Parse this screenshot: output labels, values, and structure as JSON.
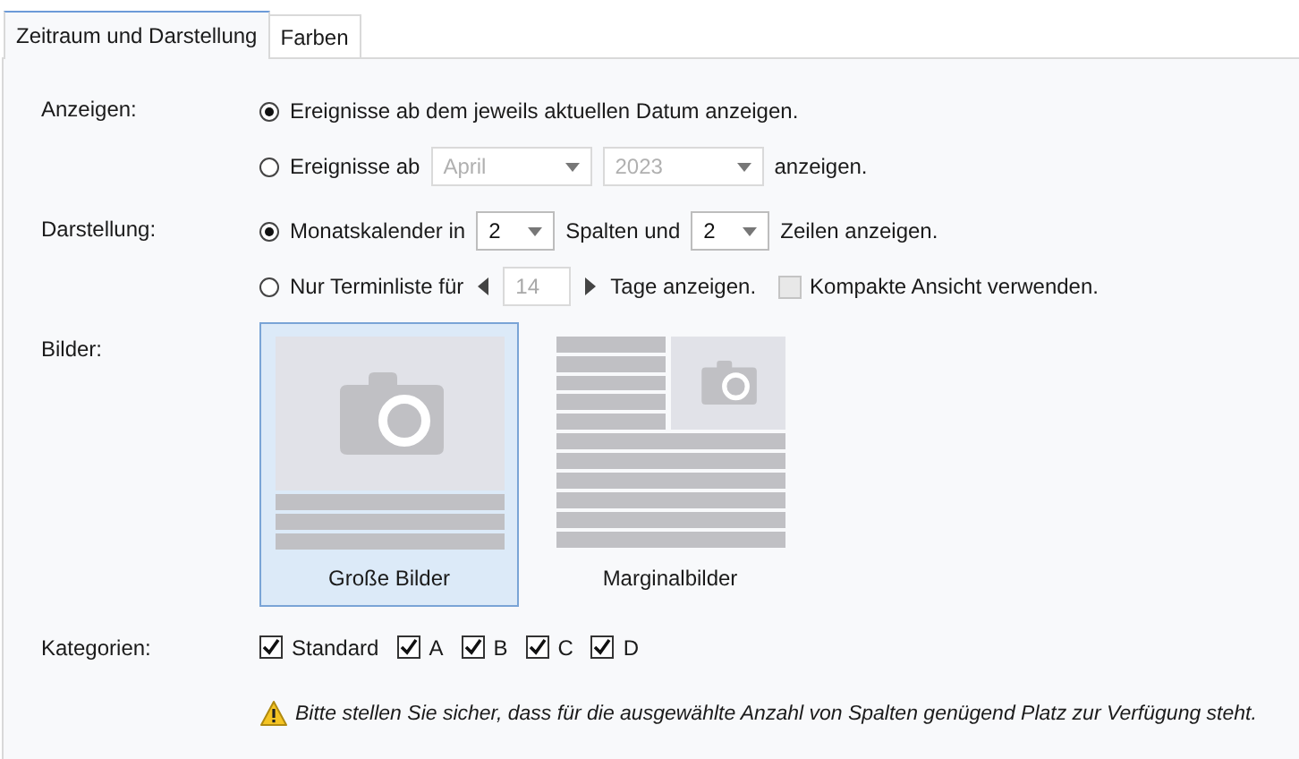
{
  "tabs": [
    {
      "label": "Zeitraum und Darstellung",
      "selected": true
    },
    {
      "label": "Farben",
      "selected": false
    }
  ],
  "anzeigen": {
    "label": "Anzeigen:",
    "options": [
      {
        "selected": true,
        "parts": [
          {
            "kind": "text",
            "text": "Ereignisse ab dem jeweils aktuellen Datum anzeigen."
          }
        ]
      },
      {
        "selected": false,
        "parts": [
          {
            "kind": "text",
            "text": "Ereignisse ab"
          },
          {
            "kind": "dropdown",
            "value": "April",
            "disabled": true
          },
          {
            "kind": "dropdown",
            "value": "2023",
            "disabled": true
          },
          {
            "kind": "text",
            "text": "anzeigen."
          }
        ]
      }
    ]
  },
  "darstellung": {
    "label": "Darstellung:",
    "options": [
      {
        "selected": true,
        "parts": [
          {
            "kind": "text",
            "text": "Monatskalender in"
          },
          {
            "kind": "dropdown",
            "value": "2",
            "disabled": false
          },
          {
            "kind": "text",
            "text": "Spalten und"
          },
          {
            "kind": "dropdown",
            "value": "2",
            "disabled": false
          },
          {
            "kind": "text",
            "text": "Zeilen anzeigen."
          }
        ]
      },
      {
        "selected": false,
        "parts": [
          {
            "kind": "text",
            "text": "Nur Terminliste für"
          },
          {
            "kind": "spinner",
            "value": "14",
            "disabled": true
          },
          {
            "kind": "text",
            "text": "Tage anzeigen."
          },
          {
            "kind": "checkbox",
            "label": "Kompakte Ansicht verwenden.",
            "checked": false,
            "disabled": true
          }
        ]
      }
    ]
  },
  "bilder": {
    "label": "Bilder:",
    "options": [
      {
        "kind": "large",
        "label": "Große Bilder",
        "selected": true
      },
      {
        "kind": "margin",
        "label": "Marginalbilder",
        "selected": false
      }
    ]
  },
  "kategorien": {
    "label": "Kategorien:",
    "items": [
      {
        "label": "Standard",
        "checked": true
      },
      {
        "label": "A",
        "checked": true
      },
      {
        "label": "B",
        "checked": true
      },
      {
        "label": "C",
        "checked": true
      },
      {
        "label": "D",
        "checked": true
      }
    ]
  },
  "warning": {
    "text": "Bitte stellen Sie sicher, dass für die ausgewählte Anzahl von Spalten genügend Platz zur Verfügung steht."
  }
}
